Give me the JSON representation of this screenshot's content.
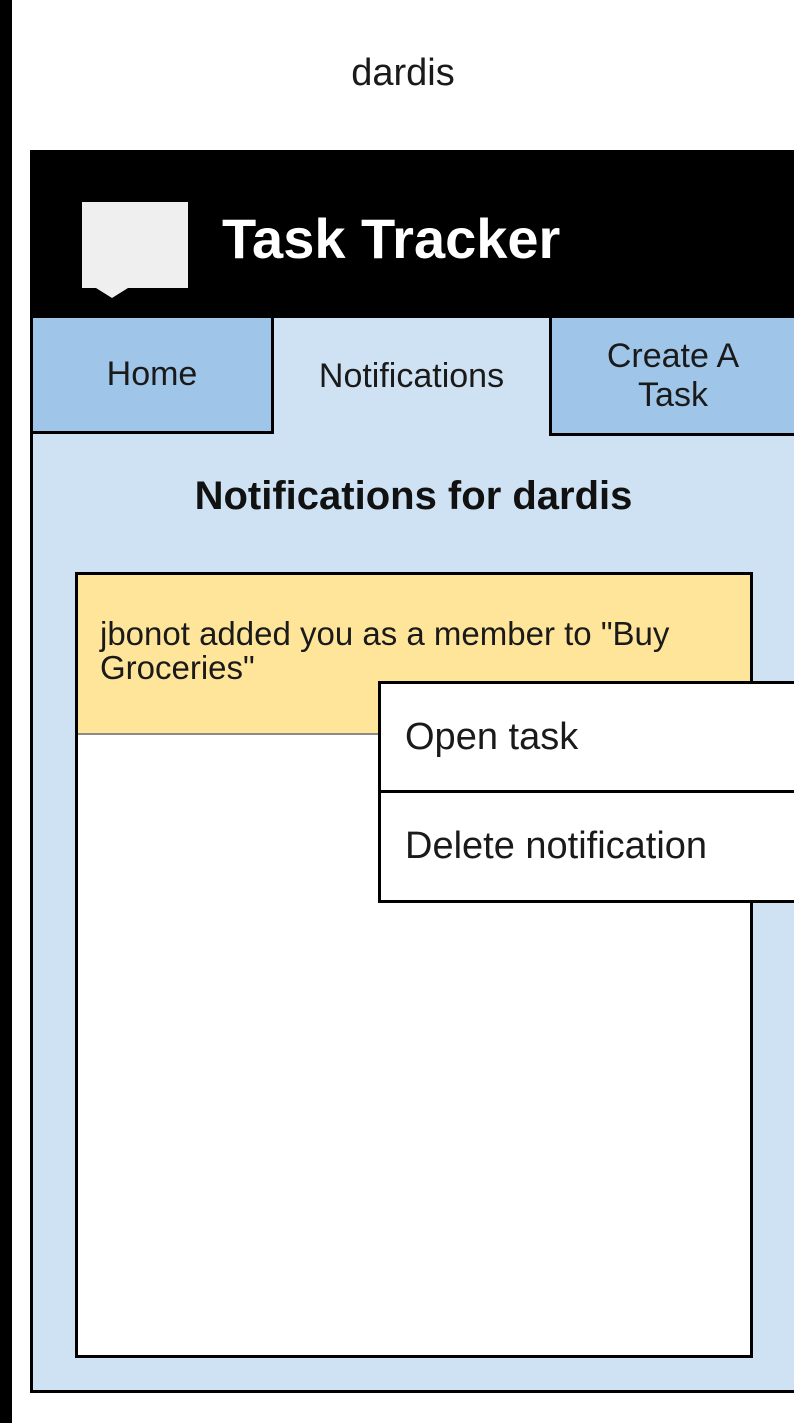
{
  "device_label": "dardis",
  "header": {
    "title": "Task Tracker",
    "logo_icon": "speech-bubble-icon"
  },
  "tabs": [
    {
      "label": "Home",
      "active": false
    },
    {
      "label": "Notifications",
      "active": true
    },
    {
      "label": "Create A Task",
      "active": false
    }
  ],
  "main": {
    "heading": "Notifications for dardis",
    "notifications": [
      {
        "text": "jbonot added you as a member to \"Buy Groceries\""
      }
    ]
  },
  "context_menu": {
    "items": [
      {
        "label": "Open task"
      },
      {
        "label": "Delete notification"
      }
    ]
  },
  "colors": {
    "header_bg": "#000000",
    "page_bg": "#cfe2f3",
    "inactive_tab_bg": "#9fc5e8",
    "notification_bg": "#ffe599"
  }
}
